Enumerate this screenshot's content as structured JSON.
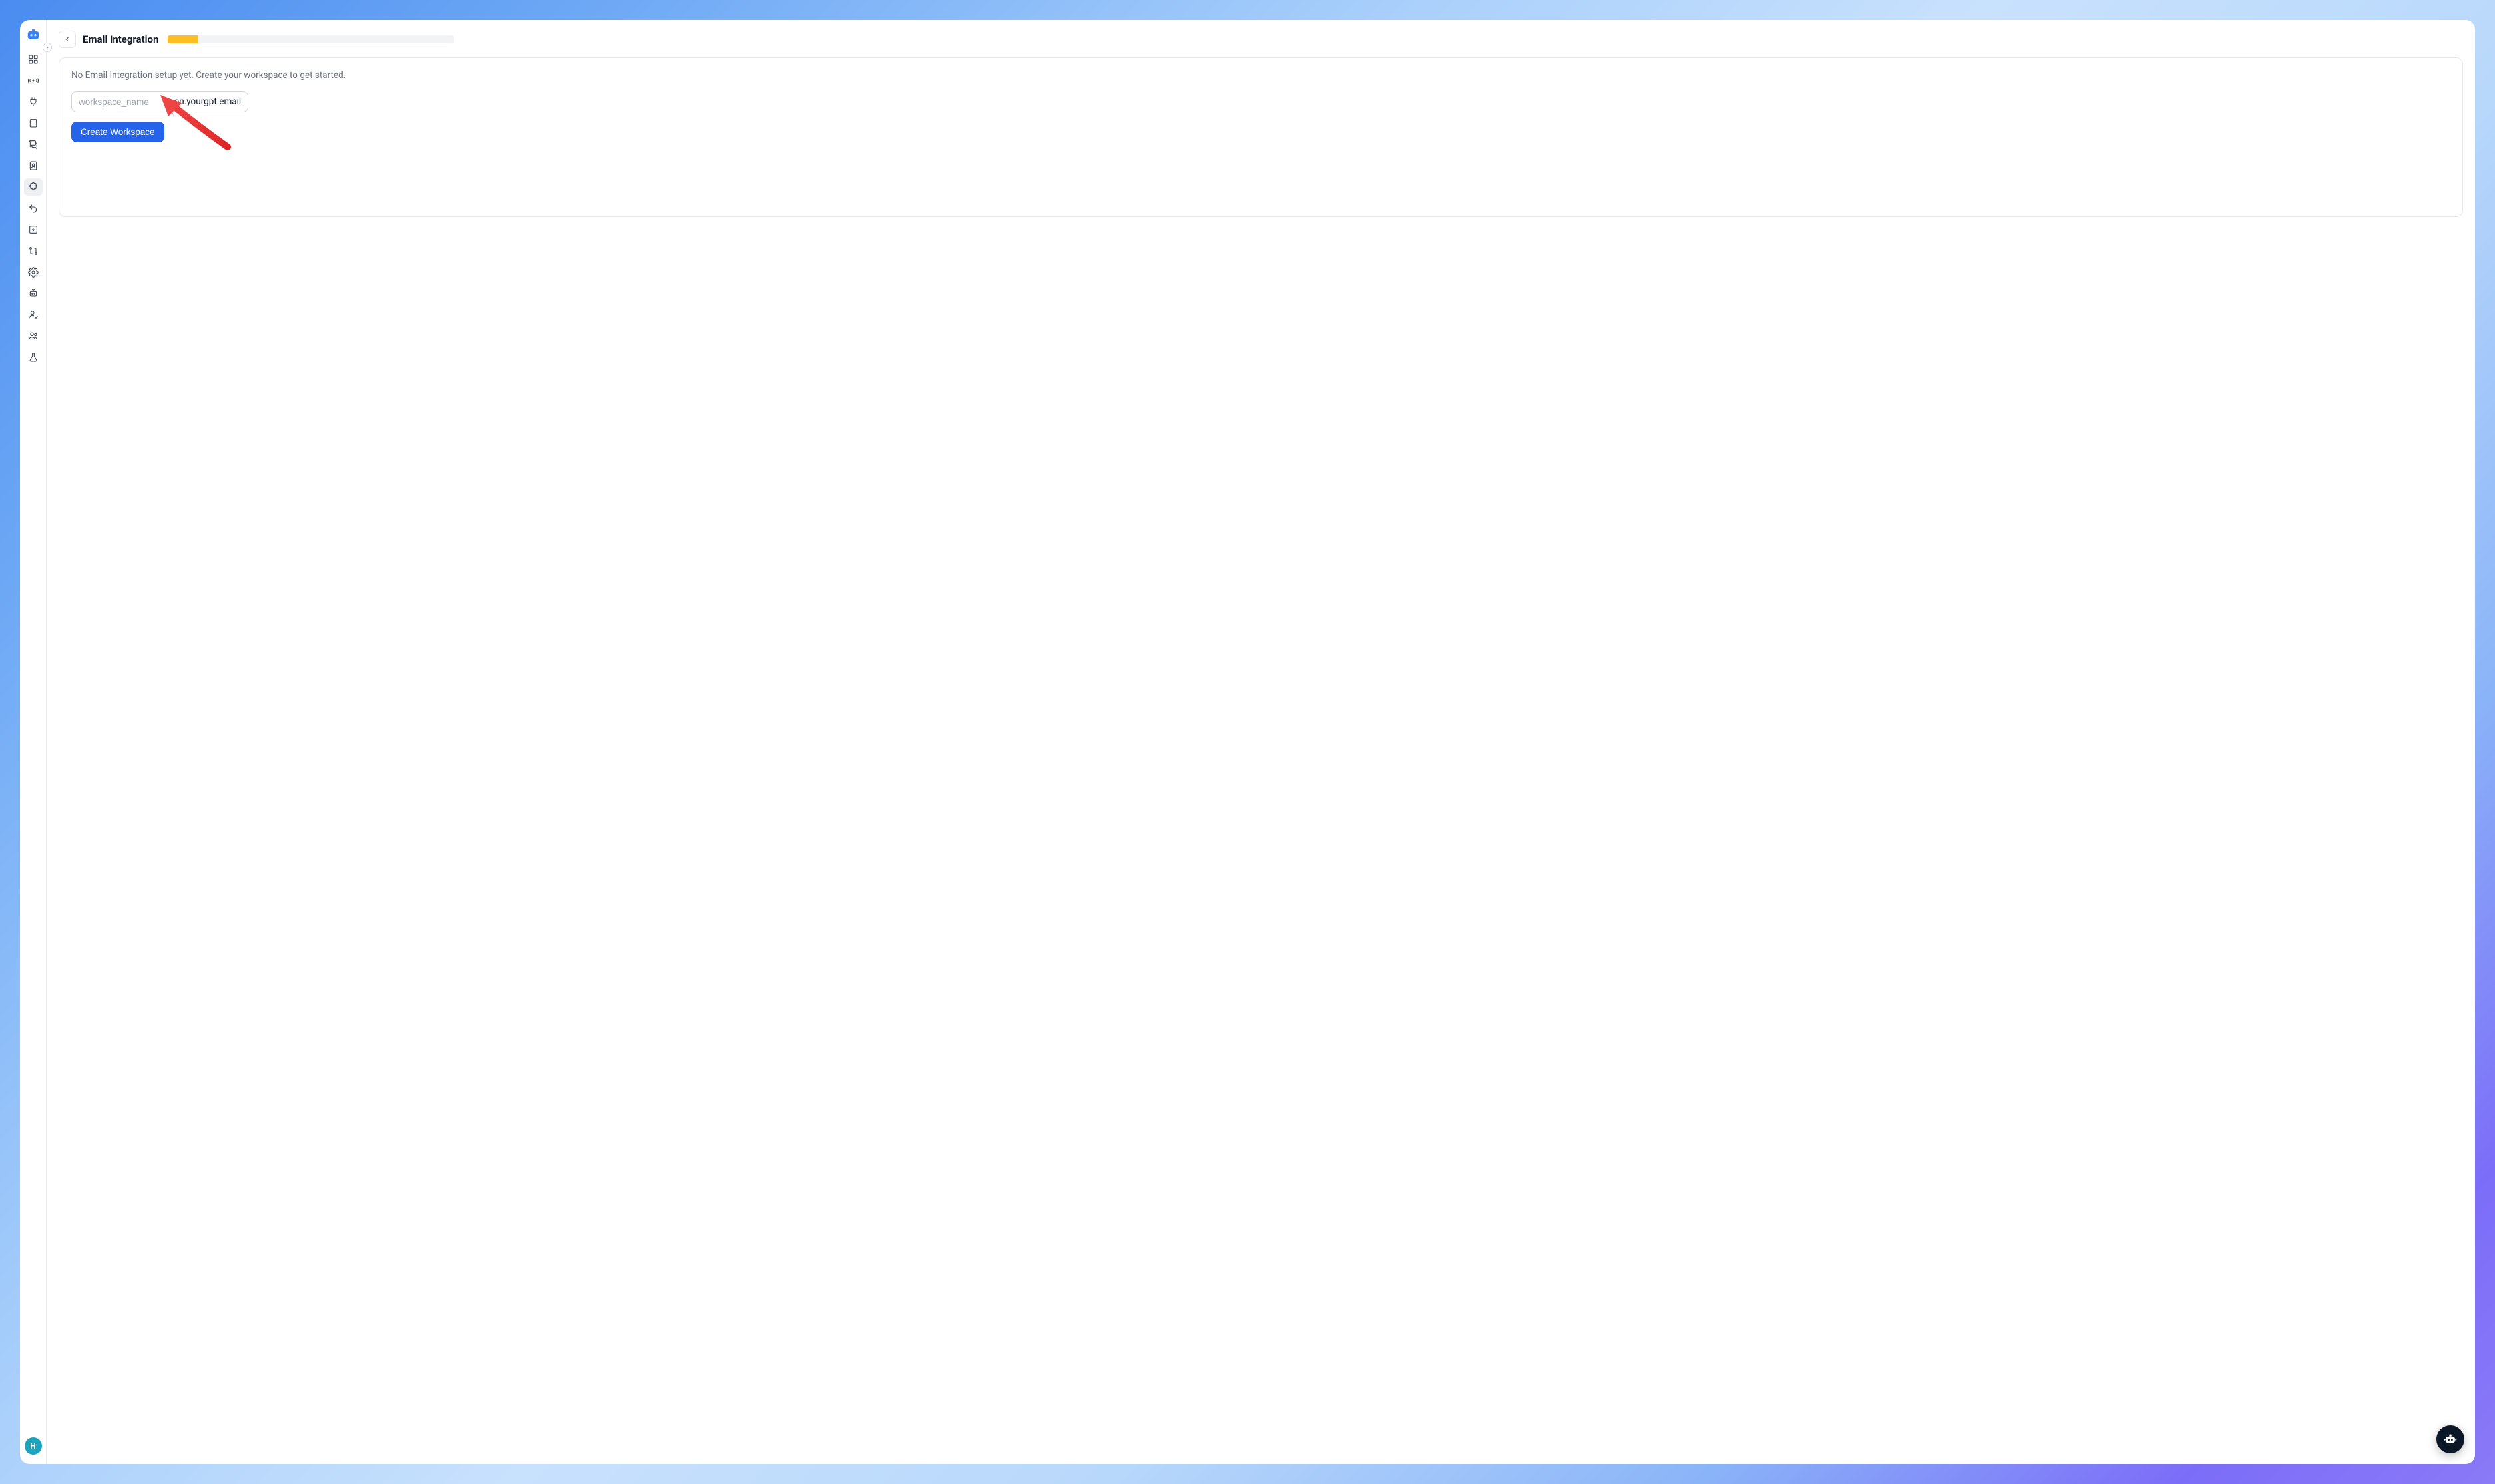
{
  "header": {
    "title": "Email Integration",
    "progress_percent": 10.5
  },
  "content": {
    "hint": "No Email Integration setup yet. Create your workspace to get started.",
    "workspace_placeholder": "workspace_name",
    "workspace_suffix": ".on.yourgpt.email",
    "create_button": "Create Workspace"
  },
  "user": {
    "avatar_initial": "H"
  },
  "sidebar": {
    "items": [
      {
        "name": "dashboard-icon"
      },
      {
        "name": "broadcast-icon"
      },
      {
        "name": "plug-icon"
      },
      {
        "name": "book-icon"
      },
      {
        "name": "chat-icon"
      },
      {
        "name": "contact-icon"
      },
      {
        "name": "puzzle-icon",
        "active": true
      },
      {
        "name": "undo-icon"
      },
      {
        "name": "bolt-icon"
      },
      {
        "name": "git-compare-icon"
      },
      {
        "name": "settings-icon"
      },
      {
        "name": "bot-icon"
      },
      {
        "name": "user-check-icon"
      },
      {
        "name": "users-icon"
      },
      {
        "name": "flask-icon"
      }
    ]
  }
}
